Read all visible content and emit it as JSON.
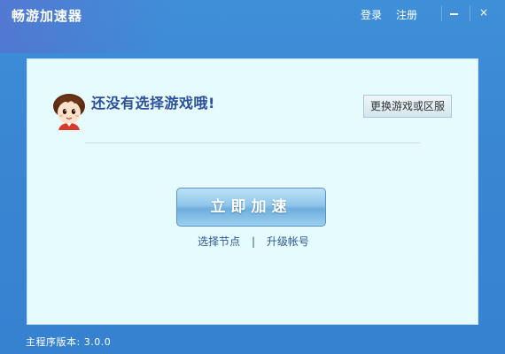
{
  "window": {
    "title": "畅游加速器"
  },
  "header": {
    "login_label": "登录",
    "register_label": "注册",
    "minimize_label": "—",
    "close_label": "×"
  },
  "main": {
    "headline": "还没有选择游戏哦!",
    "change_game_label": "更换游戏或区服",
    "accelerate_label": "立即加速",
    "select_node_label": "选择节点",
    "separator": "|",
    "upgrade_account_label": "升级帐号"
  },
  "footer": {
    "version_text": "主程序版本: 3.0.0"
  },
  "icons": {
    "avatar": "cartoon-boy-avatar-icon",
    "minimize": "minimize-icon",
    "close": "close-icon"
  },
  "colors": {
    "titlebar_blue": "#3a86d3",
    "panel_bg": "#e5fbfd",
    "headline_text": "#2c4e9b",
    "link_text": "#2c5596"
  }
}
